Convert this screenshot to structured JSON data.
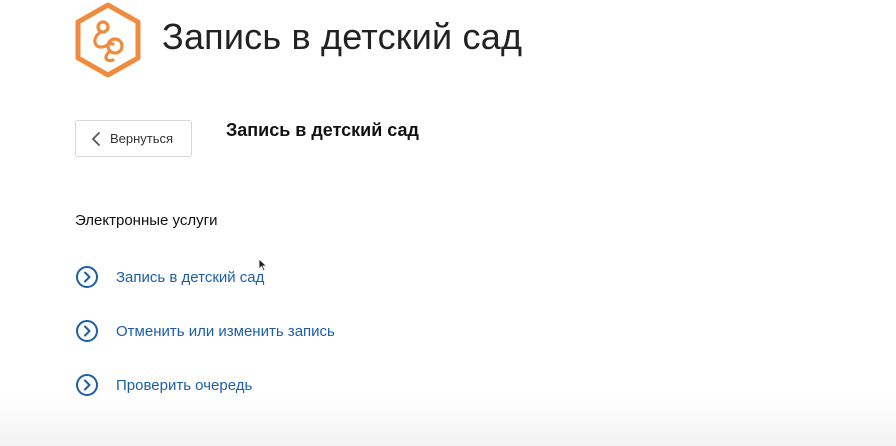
{
  "header": {
    "logo_icon": "pacifier-hexagon-icon",
    "title": "Запись в детский сад",
    "accent_color": "#f08a3c"
  },
  "toolbar": {
    "back_label": "Вернуться",
    "back_icon": "chevron-left-icon"
  },
  "main": {
    "section_title": "Запись в детский сад",
    "services_heading": "Электронные услуги",
    "services": [
      {
        "label": "Запись в детский сад",
        "icon": "arrow-circle-right-icon"
      },
      {
        "label": "Отменить или изменить запись",
        "icon": "arrow-circle-right-icon"
      },
      {
        "label": "Проверить очередь",
        "icon": "arrow-circle-right-icon"
      }
    ],
    "link_color": "#1d5ea8"
  }
}
